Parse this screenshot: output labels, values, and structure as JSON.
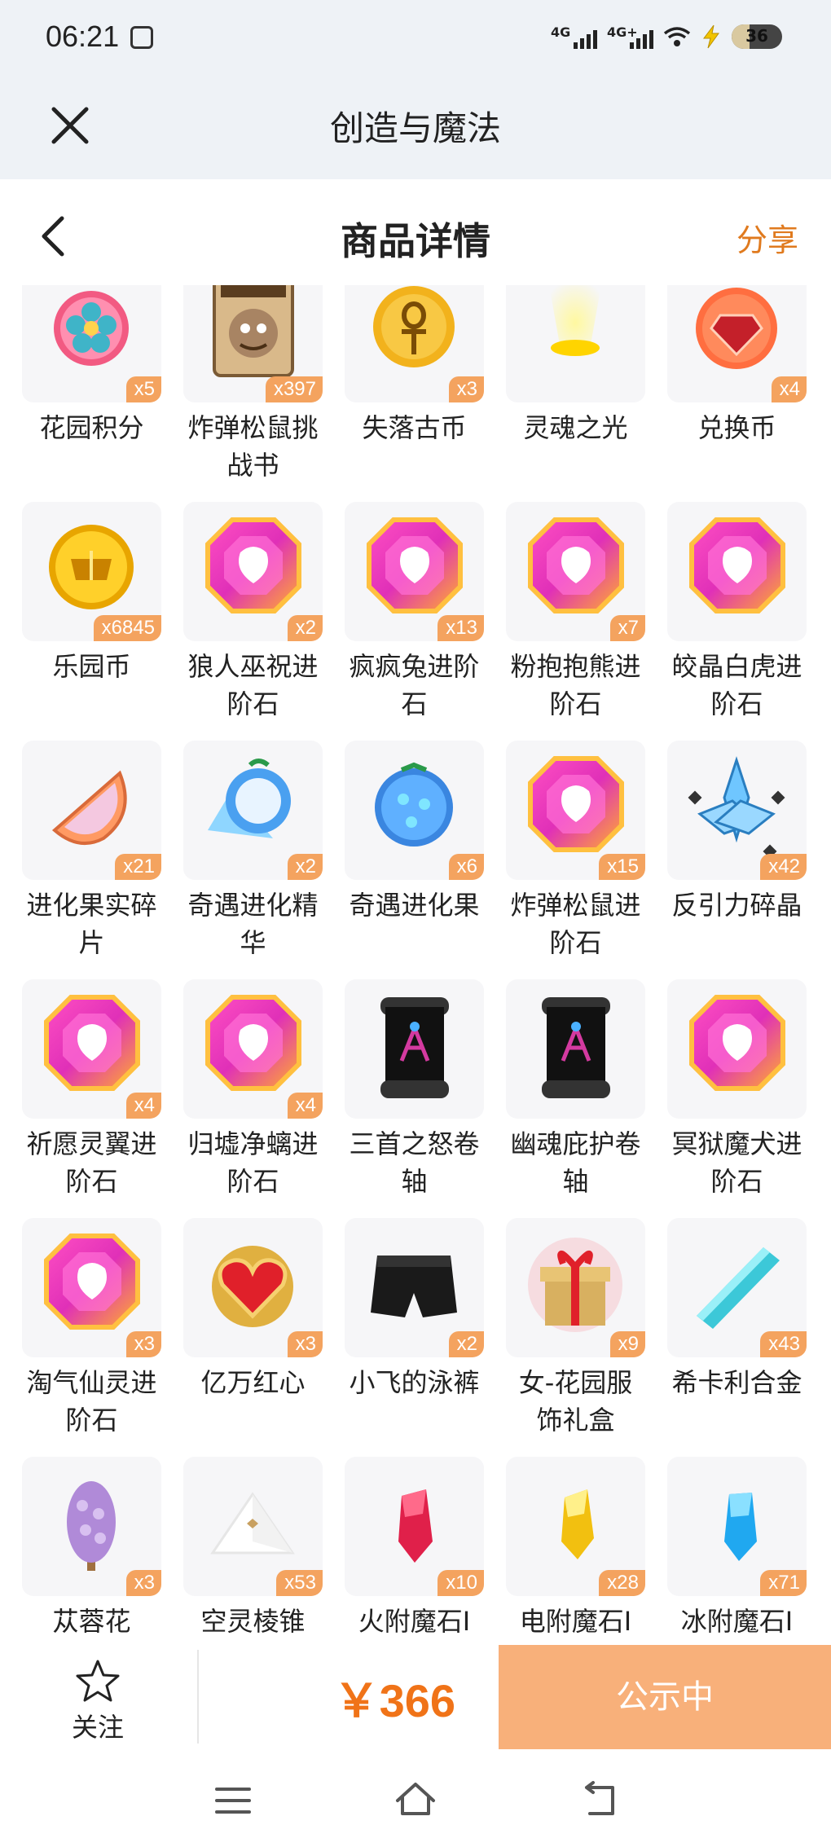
{
  "status_bar": {
    "time": "06:21",
    "net1": "4G",
    "net2": "4G+",
    "battery_level": "36",
    "battery_fraction": 0.36
  },
  "app_bar": {
    "title": "创造与魔法"
  },
  "header": {
    "title": "商品详情",
    "share": "分享"
  },
  "items": [
    {
      "name": "花园积分",
      "qty": "x5",
      "icon": "flower-badge-icon"
    },
    {
      "name": "炸弹松鼠挑战书",
      "qty": "x397",
      "icon": "wanted-poster-icon"
    },
    {
      "name": "失落古币",
      "qty": "x3",
      "icon": "ankh-coin-icon"
    },
    {
      "name": "灵魂之光",
      "qty": "",
      "icon": "soul-light-icon"
    },
    {
      "name": "兑换币",
      "qty": "x4",
      "icon": "red-gem-coin-icon"
    },
    {
      "name": "乐园币",
      "qty": "x6845",
      "icon": "gold-coin-icon"
    },
    {
      "name": "狼人巫祝进阶石",
      "qty": "x2",
      "icon": "advance-stone-icon"
    },
    {
      "name": "疯疯兔进阶石",
      "qty": "x13",
      "icon": "advance-stone-icon"
    },
    {
      "name": "粉抱抱熊进阶石",
      "qty": "x7",
      "icon": "advance-stone-icon"
    },
    {
      "name": "皎晶白虎进阶石",
      "qty": "",
      "icon": "advance-stone-icon"
    },
    {
      "name": "进化果实碎片",
      "qty": "x21",
      "icon": "fruit-slice-icon"
    },
    {
      "name": "奇遇进化精华",
      "qty": "x2",
      "icon": "crystal-fruit-icon"
    },
    {
      "name": "奇遇进化果",
      "qty": "x6",
      "icon": "blue-fruit-icon"
    },
    {
      "name": "炸弹松鼠进阶石",
      "qty": "x15",
      "icon": "advance-stone-icon"
    },
    {
      "name": "反引力碎晶",
      "qty": "x42",
      "icon": "antigravity-crystal-icon"
    },
    {
      "name": "祈愿灵翼进阶石",
      "qty": "x4",
      "icon": "advance-stone-icon"
    },
    {
      "name": "归墟净螭进阶石",
      "qty": "x4",
      "icon": "advance-stone-icon"
    },
    {
      "name": "三首之怒卷轴",
      "qty": "",
      "icon": "scroll-icon"
    },
    {
      "name": "幽魂庇护卷轴",
      "qty": "",
      "icon": "scroll-icon"
    },
    {
      "name": "冥狱魔犬进阶石",
      "qty": "",
      "icon": "advance-stone-icon"
    },
    {
      "name": "淘气仙灵进阶石",
      "qty": "x3",
      "icon": "advance-stone-icon"
    },
    {
      "name": "亿万红心",
      "qty": "x3",
      "icon": "red-heart-icon"
    },
    {
      "name": "小飞的泳裤",
      "qty": "x2",
      "icon": "swim-shorts-icon"
    },
    {
      "name": "女-花园服饰礼盒",
      "qty": "x9",
      "icon": "gift-box-icon"
    },
    {
      "name": "希卡利合金",
      "qty": "x43",
      "icon": "alloy-bar-icon"
    },
    {
      "name": "苁蓉花",
      "qty": "x3",
      "icon": "purple-flower-icon"
    },
    {
      "name": "空灵棱锥",
      "qty": "x53",
      "icon": "white-pyramid-icon"
    },
    {
      "name": "火附魔石Ⅰ",
      "qty": "x10",
      "icon": "red-crystal-icon"
    },
    {
      "name": "电附魔石Ⅰ",
      "qty": "x28",
      "icon": "yellow-crystal-icon"
    },
    {
      "name": "冰附魔石Ⅰ",
      "qty": "x71",
      "icon": "blue-crystal-icon"
    }
  ],
  "action_bar": {
    "follow": "关注",
    "price": "￥366",
    "status_button": "公示中"
  },
  "colors": {
    "accent": "#f07318",
    "share": "#e07a1e",
    "badge": "#f4a35f",
    "status_button": "#f8b07a"
  }
}
